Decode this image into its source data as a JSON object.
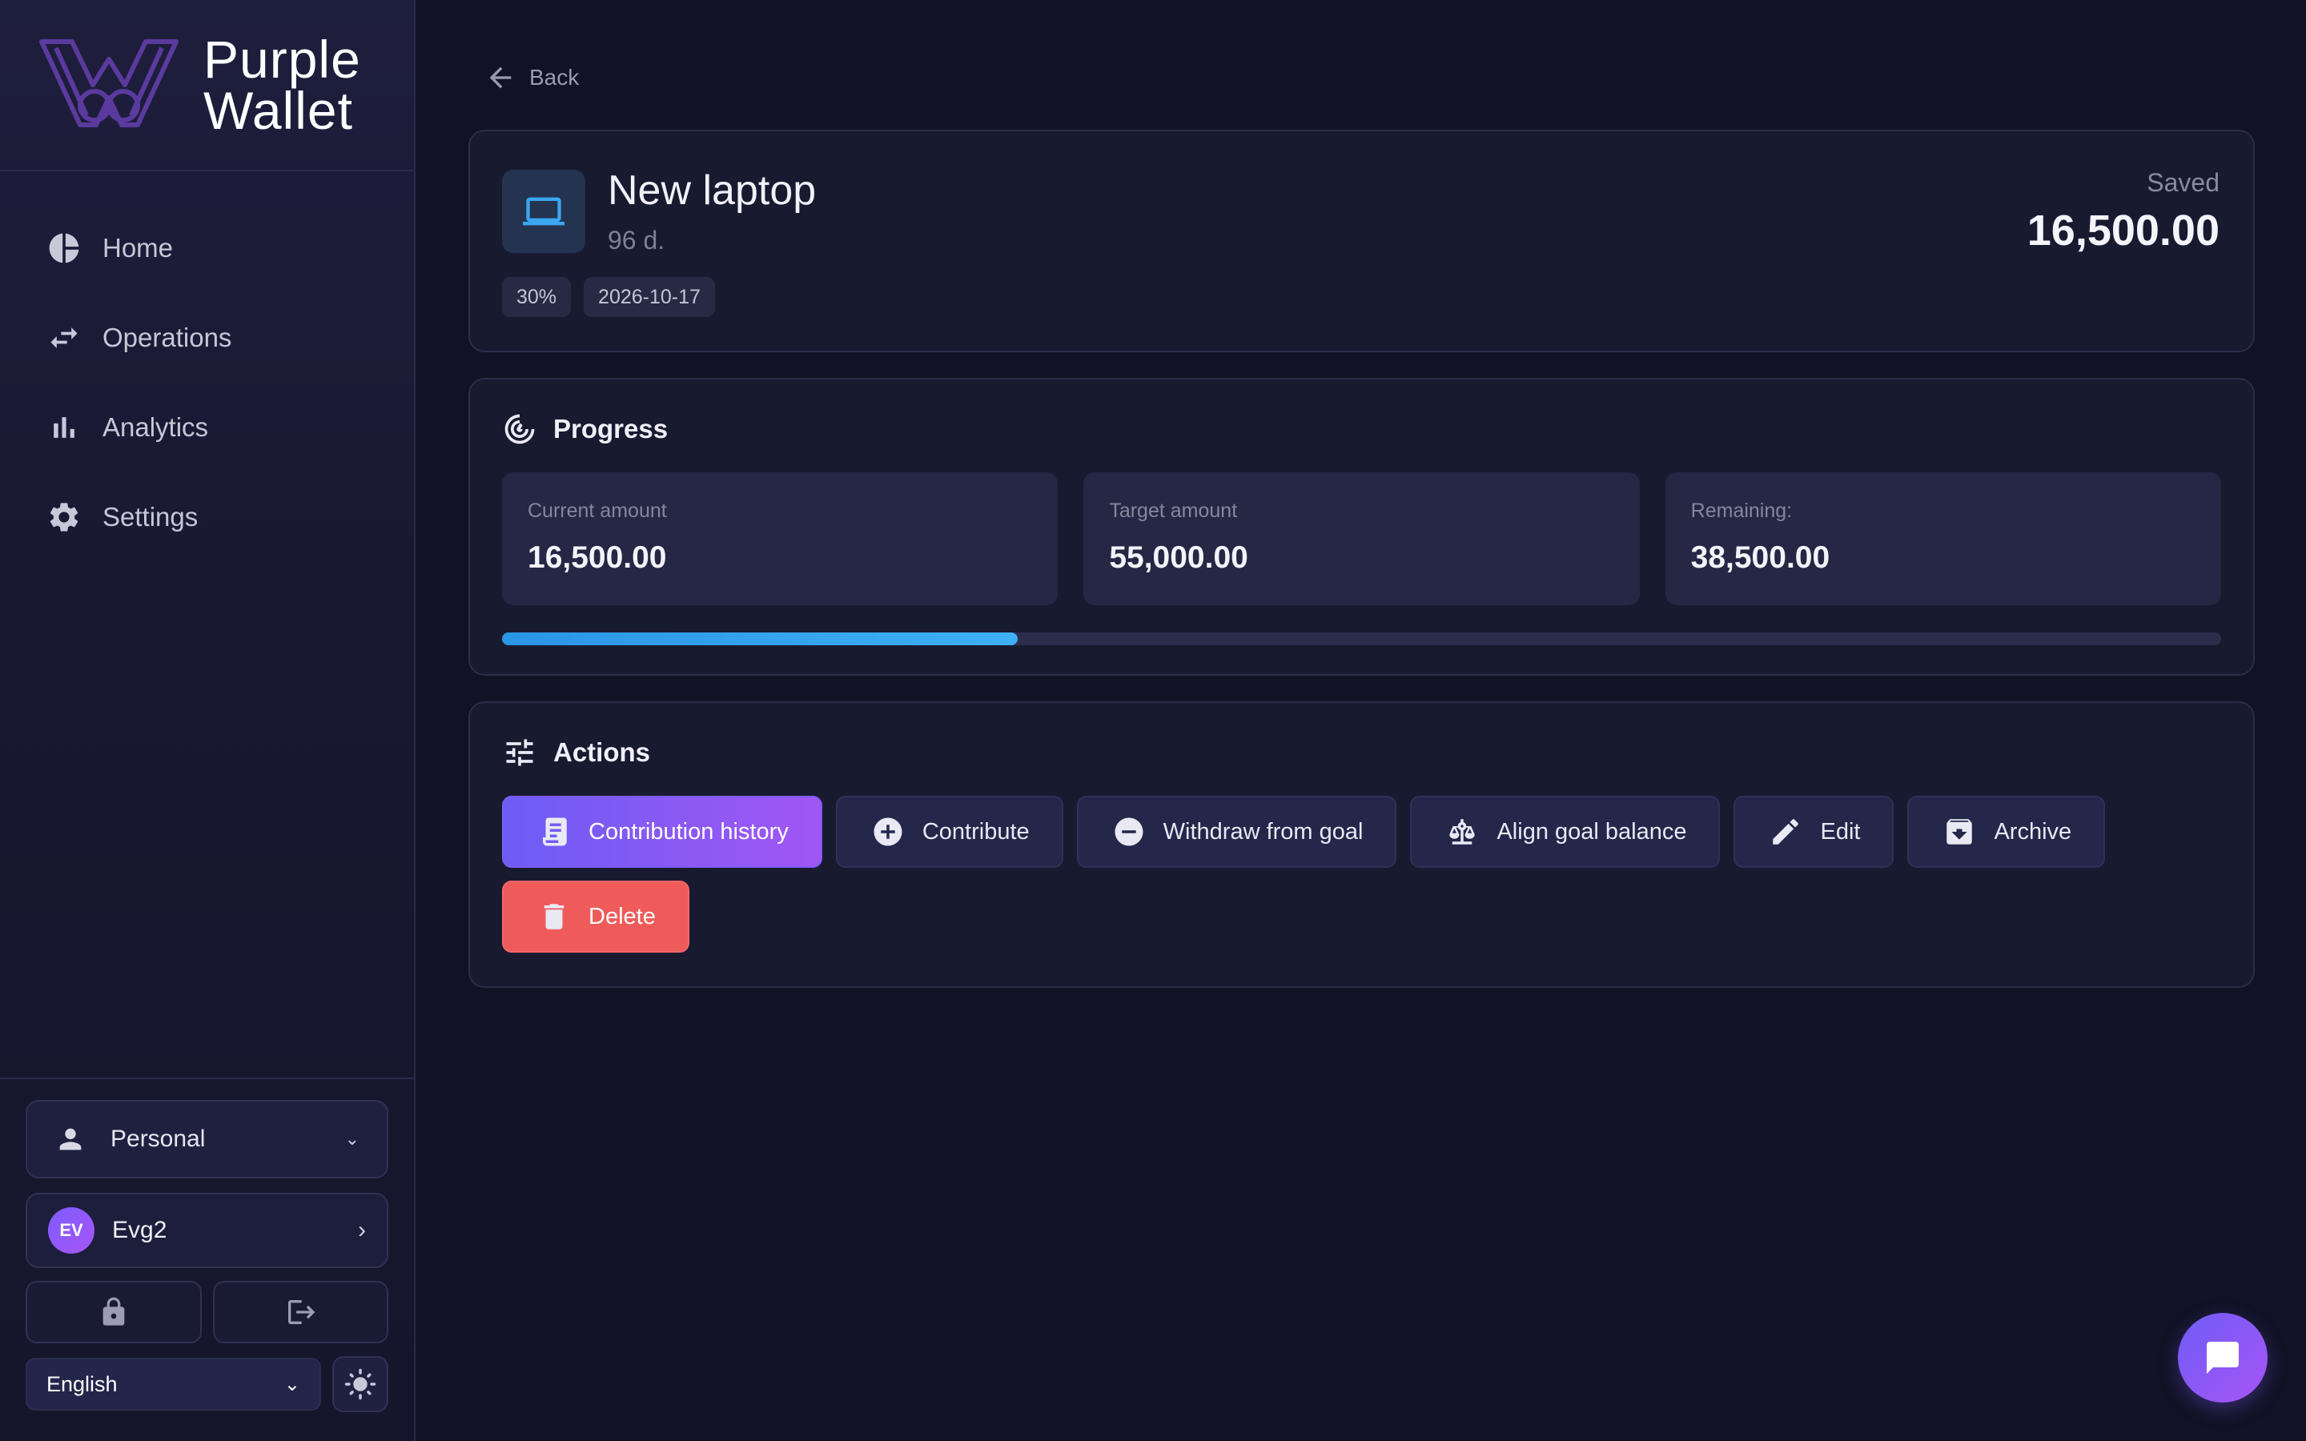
{
  "brand": {
    "line1": "Purple",
    "line2": "Wallet"
  },
  "nav": {
    "items": [
      {
        "label": "Home",
        "icon": "pie-chart-icon"
      },
      {
        "label": "Operations",
        "icon": "swap-arrows-icon"
      },
      {
        "label": "Analytics",
        "icon": "bar-chart-icon"
      },
      {
        "label": "Settings",
        "icon": "gear-icon"
      }
    ]
  },
  "account_context": {
    "value": "Personal",
    "icon": "person-icon"
  },
  "user": {
    "initials": "EV",
    "name": "Evg2"
  },
  "language": {
    "value": "English"
  },
  "back_label": "Back",
  "goal": {
    "title": "New laptop",
    "days_left": "96 d.",
    "percent_chip": "30%",
    "date_chip": "2026-10-17",
    "saved_label": "Saved",
    "saved_value": "16,500.00",
    "icon": "laptop-icon"
  },
  "progress": {
    "title": "Progress",
    "current_label": "Current amount",
    "current_value": "16,500.00",
    "target_label": "Target amount",
    "target_value": "55,000.00",
    "remaining_label": "Remaining:",
    "remaining_value": "38,500.00",
    "fraction": 0.3
  },
  "actions": {
    "title": "Actions",
    "contribution_history": "Contribution history",
    "contribute": "Contribute",
    "withdraw": "Withdraw from goal",
    "align_balance": "Align goal balance",
    "edit": "Edit",
    "archive": "Archive",
    "delete": "Delete"
  },
  "colors": {
    "accent": "#7c5cf7",
    "progress_fill": "#3aa8f2",
    "danger": "#ef5b5b",
    "background": "#111225"
  }
}
